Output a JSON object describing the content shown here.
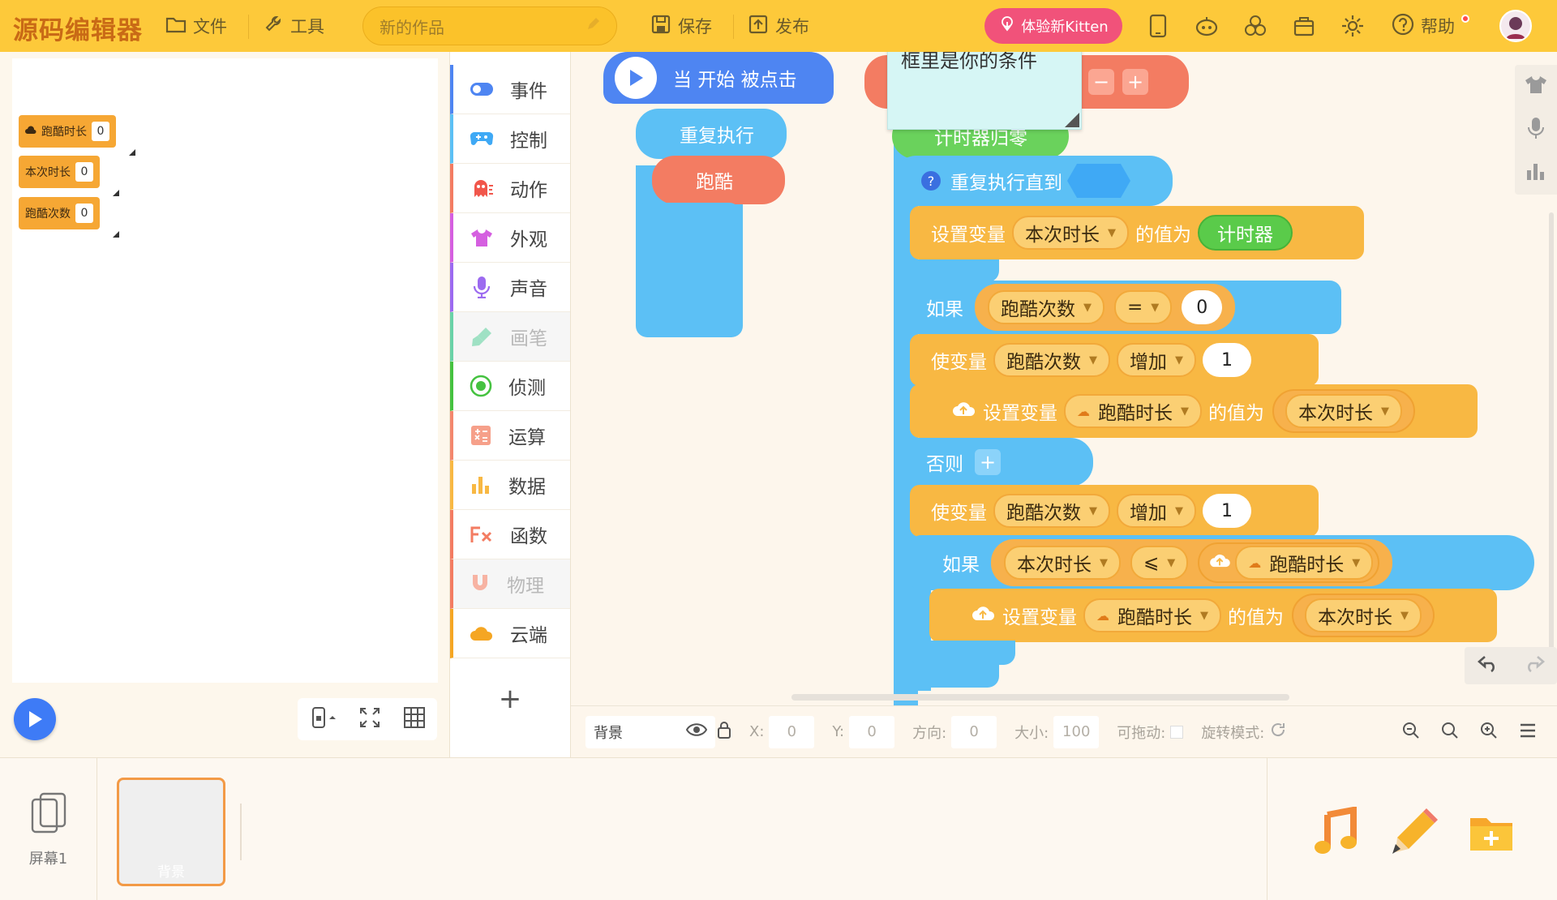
{
  "app": {
    "logo": "源码编辑器"
  },
  "toolbar": {
    "file": "文件",
    "tools": "工具",
    "project_title": "新的作品",
    "save": "保存",
    "publish": "发布",
    "kitten_button": "体验新Kitten",
    "help": "帮助",
    "accent_color": "#fdc93a"
  },
  "stage": {
    "monitors": [
      {
        "label": "跑酷时长",
        "value": "0",
        "cloud": true
      },
      {
        "label": "本次时长",
        "value": "0",
        "cloud": false
      },
      {
        "label": "跑酷次数",
        "value": "0",
        "cloud": false
      }
    ]
  },
  "categories": [
    {
      "label": "事件",
      "icon": "toggle-icon",
      "color": "#4e85f2"
    },
    {
      "label": "控制",
      "icon": "gamepad-icon",
      "color": "#5cc0f5"
    },
    {
      "label": "动作",
      "icon": "ghost-icon",
      "color": "#f37c62"
    },
    {
      "label": "外观",
      "icon": "shirt-icon",
      "color": "#d55fe0"
    },
    {
      "label": "声音",
      "icon": "microphone-icon",
      "color": "#9c6af0"
    },
    {
      "label": "画笔",
      "icon": "brush-icon",
      "color": "#6ad2a8"
    },
    {
      "label": "侦测",
      "icon": "target-icon",
      "color": "#45c240"
    },
    {
      "label": "运算",
      "icon": "calculator-icon",
      "color": "#f3876d"
    },
    {
      "label": "数据",
      "icon": "bar-chart-icon",
      "color": "#f8b843"
    },
    {
      "label": "函数",
      "icon": "function-icon",
      "color": "#f37c62"
    },
    {
      "label": "物理",
      "icon": "magnet-icon",
      "color": "#f37c62"
    },
    {
      "label": "云端",
      "icon": "cloud-icon",
      "color": "#f5a623"
    }
  ],
  "blocks": {
    "when_start": "当 开始 被点击",
    "repeat_forever": "重复执行",
    "parkour": "跑酷",
    "comment_text": "框里是你的条件",
    "timer_reset": "计时器归零",
    "repeat_until": "重复执行直到",
    "set_var": "设置变量",
    "value_of": "的值为",
    "timer": "计时器",
    "if": "如果",
    "else": "否则",
    "change_var": "使变量",
    "increase": "增加",
    "var_run_count": "跑酷次数",
    "var_this_time": "本次时长",
    "var_best_time": "跑酷时长",
    "op_eq": "=",
    "op_le": "⩽",
    "num_zero": "0",
    "num_one": "1"
  },
  "property_bar": {
    "sprite_name": "背景",
    "x_label": "X:",
    "x_value": "0",
    "y_label": "Y:",
    "y_value": "0",
    "dir_label": "方向:",
    "dir_value": "0",
    "size_label": "大小:",
    "size_value": "100",
    "drag_label": "可拖动:",
    "rotate_label": "旋转模式:"
  },
  "bottom": {
    "screen_label": "屏幕1",
    "background_label": "背景"
  }
}
